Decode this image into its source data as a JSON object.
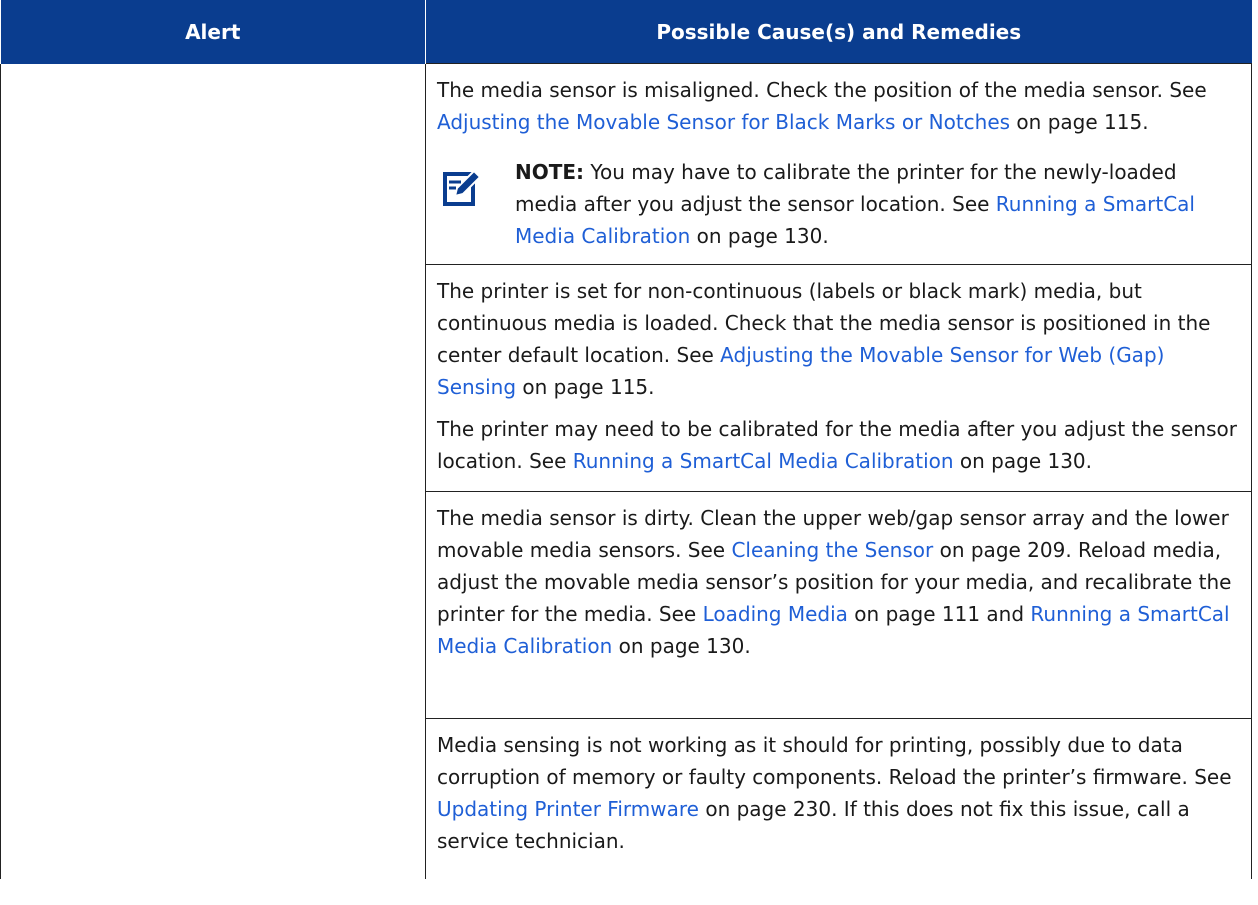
{
  "header": {
    "alert": "Alert",
    "causes": "Possible Cause(s) and Remedies"
  },
  "rows": [
    {
      "cause": {
        "t1": "The media sensor is misaligned. Check the position of the media sensor. See ",
        "link1": "Adjusting the Movable Sensor for Black Marks or Notches",
        "t2": " on page 115."
      },
      "note": {
        "label": "NOTE:",
        "t1": " You may have to calibrate the printer for the newly-loaded media after you adjust the sensor location. See ",
        "link1": "Running a SmartCal Media Calibration",
        "t2": " on page 130."
      }
    },
    {
      "p1": {
        "t1": "The printer is set for non-continuous (labels or black mark) media, but continuous media is loaded. Check that the media sensor is positioned in the center default location. See ",
        "link1": "Adjusting the Movable Sensor for Web (Gap) Sensing",
        "t2": " on page 115."
      },
      "p2": {
        "t1": "The printer may need to be calibrated for the media after you adjust the sensor location. See ",
        "link1": "Running a SmartCal Media Calibration",
        "t2": " on page 130."
      }
    },
    {
      "t1": "The media sensor is dirty. Clean the upper web/gap sensor array and the lower movable media sensors. See ",
      "link1": "Cleaning the Sensor",
      "t2": " on page 209. Reload media, adjust the movable media sensor’s position for your media, and recalibrate the printer for the media. See ",
      "link2": "Loading Media",
      "t3": " on page 111 and ",
      "link3": "Running a SmartCal Media Calibration",
      "t4": " on page 130."
    },
    {
      "t1": "Media sensing is not working as it should for printing, possibly due to data corruption of memory or faulty components. Reload the printer’s firmware. See ",
      "link1": "Updating Printer Firmware",
      "t2": " on page 230. If this does not fix this issue, call a service technician."
    }
  ],
  "colors": {
    "header_bg": "#0a3d8f",
    "link": "#1f5fd6",
    "note_icon": "#0a3d8f"
  },
  "icons": {
    "note": "note-edit-icon"
  }
}
